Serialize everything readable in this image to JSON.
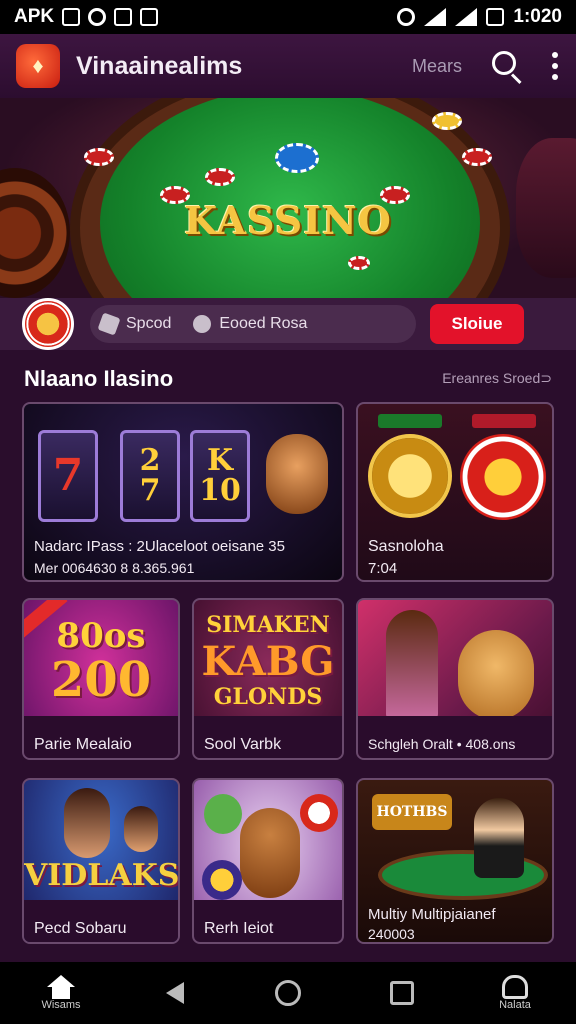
{
  "status_bar": {
    "left_label": "APK",
    "time": "1:020"
  },
  "header": {
    "title": "Vinaainealims",
    "link": "Mears"
  },
  "hero": {
    "title": "KASSINO"
  },
  "action_bar": {
    "pill_1": "Spcod",
    "pill_2": "Eooed Rosa",
    "cta": "Sloiue"
  },
  "section": {
    "title": "Nlaano Ilasino",
    "link": "Ereanres Sroed⊃"
  },
  "cards": [
    {
      "reel_1": "",
      "reel_2_top": "2",
      "reel_2_bottom": "7",
      "reel_3_top": "K",
      "reel_3_bottom": "10",
      "line_1": "Nadarc IPass : 2Ulaceloot oeisane 35",
      "line_2": "Mer 0064630 8 8.365.961"
    },
    {
      "line_1": "Sasnoloha",
      "line_2": "7:04"
    },
    {
      "big_1": "80os",
      "big_2": "200",
      "caption": "Parie Mealaio"
    },
    {
      "big_1": "SIMAKEN",
      "big_2": "KABG",
      "big_3": "GLONDS",
      "caption": "Sool Varbk"
    },
    {
      "caption": "Schgleh Oralt • 408.ons"
    },
    {
      "big_1": "VIDLAKS",
      "caption": "Pecd Sobaru"
    },
    {
      "caption": "Rerh Ieiot"
    },
    {
      "sign": "HOTHBS",
      "line_1": "Multiy Multipjaianef",
      "line_2": "240003"
    }
  ],
  "bottom_nav": {
    "home_label": "Wisams",
    "alerts_label": "Nalata"
  },
  "colors": {
    "background": "#2a0d2c",
    "accent_red": "#e3122a",
    "felt_green": "#14822a",
    "gold": "#f5c542"
  },
  "icons": [
    "logo-icon",
    "search-icon",
    "more-icon",
    "chip-icon",
    "home-icon",
    "back-icon",
    "home-circle-icon",
    "recents-icon",
    "bell-icon"
  ]
}
